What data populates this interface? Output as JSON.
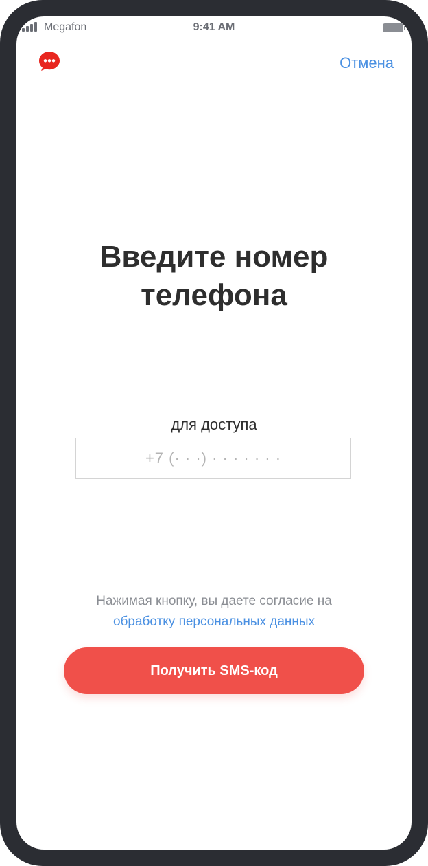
{
  "status_bar": {
    "carrier": "Megafon",
    "time": "9:41 AM"
  },
  "header": {
    "logo_icon": "chat-bubble-icon",
    "cancel_label": "Отмена"
  },
  "main": {
    "title": "Введите номер телефона",
    "field_label": "для доступа",
    "phone_placeholder": "+7 (· · ·) · · · · · · ·",
    "phone_value": "",
    "consent_text": "Нажимая кнопку, вы даете согласие на",
    "consent_link": "обработку персональных данных",
    "submit_label": "Получить SMS-код"
  },
  "colors": {
    "accent_red": "#f0504a",
    "link_blue": "#4a90e2",
    "logo_red": "#e8261f",
    "frame": "#2b2d33"
  }
}
